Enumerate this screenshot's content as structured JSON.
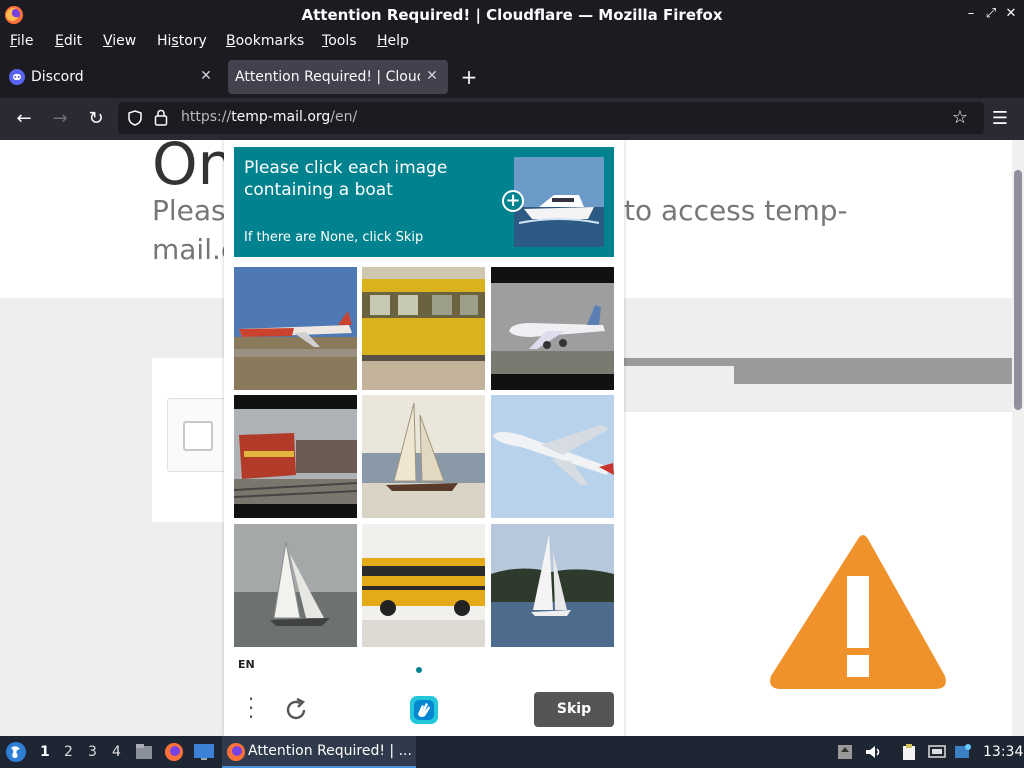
{
  "window": {
    "title": "Attention Required! | Cloudflare — Mozilla Firefox",
    "controls": [
      "minimize-icon",
      "maximize-icon",
      "close-icon"
    ]
  },
  "menubar": {
    "items": [
      {
        "pre": "",
        "key": "F",
        "post": "ile"
      },
      {
        "pre": "",
        "key": "E",
        "post": "dit"
      },
      {
        "pre": "",
        "key": "V",
        "post": "iew"
      },
      {
        "pre": "Hi",
        "key": "s",
        "post": "tory"
      },
      {
        "pre": "",
        "key": "B",
        "post": "ookmarks"
      },
      {
        "pre": "",
        "key": "T",
        "post": "ools"
      },
      {
        "pre": "",
        "key": "H",
        "post": "elp"
      }
    ]
  },
  "tabs": [
    {
      "label": "Discord",
      "icon": "discord-icon"
    },
    {
      "label": "Attention Required! | Cloudfl",
      "icon": ""
    }
  ],
  "urlbar": {
    "scheme": "https://",
    "host": "temp-mail.org",
    "path": "/en/"
  },
  "page": {
    "hero_big": "On",
    "hero_sub_line1_left": "Pleas",
    "hero_sub_line1_right": "to access temp-",
    "hero_sub_line2": "mail.c"
  },
  "captcha": {
    "prompt": "Please click each image containing a boat",
    "hint": "If there are None, click Skip",
    "language": "EN",
    "skip_label": "Skip",
    "images": [
      "airplane",
      "train",
      "airplane",
      "train",
      "sailboat",
      "airplane",
      "sailboat",
      "school-bus",
      "sailboat"
    ]
  },
  "taskbar": {
    "workspaces": [
      "1",
      "2",
      "3",
      "4"
    ],
    "active_workspace": "1",
    "task_label": "Attention Required! | ...",
    "clock": "13:34"
  },
  "colors": {
    "captcha_teal": "#00838f",
    "warning_orange": "#f0922b",
    "browser_dark": "#1c1b22"
  }
}
